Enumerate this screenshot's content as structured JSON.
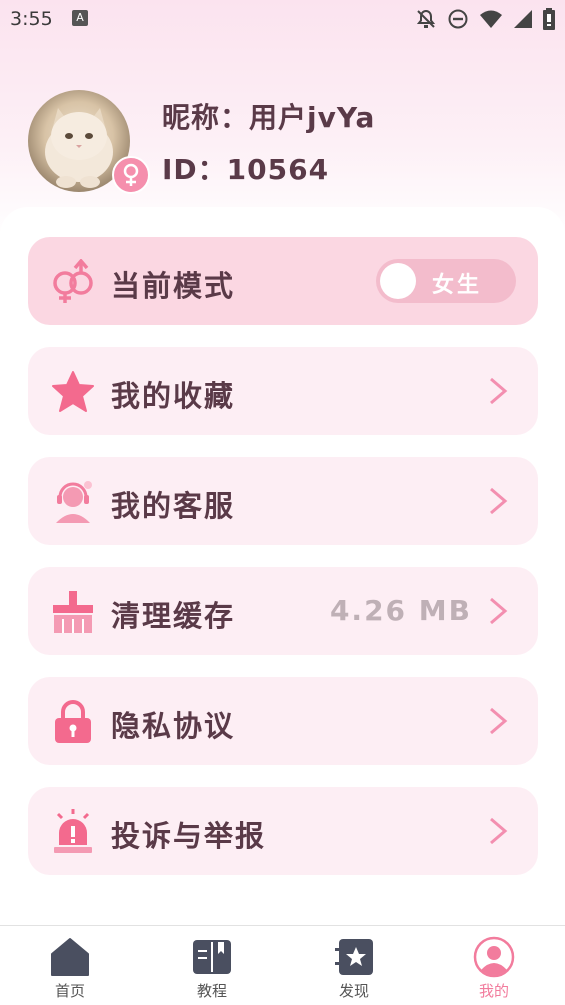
{
  "status_bar": {
    "time": "3:55",
    "notification_icon": "A"
  },
  "profile": {
    "nickname": "昵称：用户jvYa",
    "user_id": "ID：10564",
    "gender_icon": "female-icon"
  },
  "menu": {
    "mode": {
      "label": "当前模式",
      "toggle_label": "女生",
      "icon": "gender-switch-icon"
    },
    "favorites": {
      "label": "我的收藏",
      "icon": "star-icon"
    },
    "service": {
      "label": "我的客服",
      "icon": "customer-service-icon"
    },
    "cache": {
      "label": "清理缓存",
      "size": "4.26 MB",
      "icon": "broom-icon"
    },
    "privacy": {
      "label": "隐私协议",
      "icon": "lock-icon"
    },
    "report": {
      "label": "投诉与举报",
      "icon": "alarm-icon"
    }
  },
  "tabs": [
    {
      "label": "首页",
      "icon": "home-icon"
    },
    {
      "label": "教程",
      "icon": "book-icon"
    },
    {
      "label": "发现",
      "icon": "discover-icon"
    },
    {
      "label": "我的",
      "icon": "profile-icon"
    }
  ],
  "colors": {
    "accent": "#f27c9d",
    "text": "#5a3a48",
    "row_bg": "#fdeef4",
    "mode_bg": "#fbd7e2"
  }
}
